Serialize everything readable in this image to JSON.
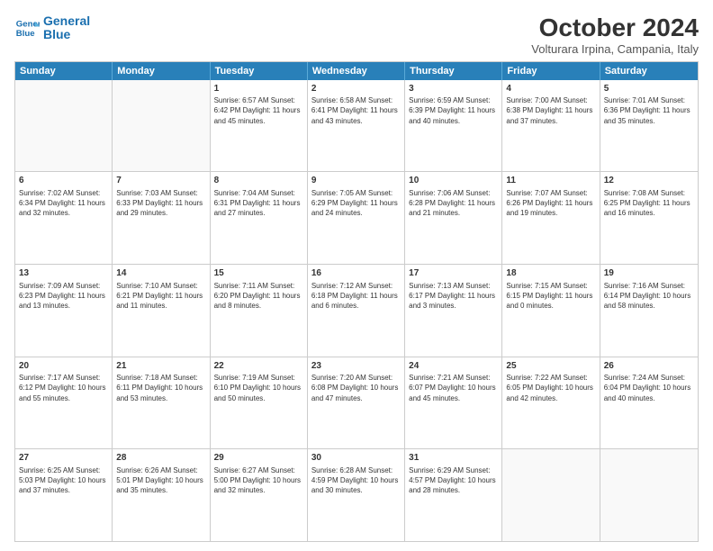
{
  "header": {
    "logo_line1": "General",
    "logo_line2": "Blue",
    "month_title": "October 2024",
    "location": "Volturara Irpina, Campania, Italy"
  },
  "weekdays": [
    "Sunday",
    "Monday",
    "Tuesday",
    "Wednesday",
    "Thursday",
    "Friday",
    "Saturday"
  ],
  "rows": [
    [
      {
        "day": "",
        "info": ""
      },
      {
        "day": "",
        "info": ""
      },
      {
        "day": "1",
        "info": "Sunrise: 6:57 AM\nSunset: 6:42 PM\nDaylight: 11 hours and 45 minutes."
      },
      {
        "day": "2",
        "info": "Sunrise: 6:58 AM\nSunset: 6:41 PM\nDaylight: 11 hours and 43 minutes."
      },
      {
        "day": "3",
        "info": "Sunrise: 6:59 AM\nSunset: 6:39 PM\nDaylight: 11 hours and 40 minutes."
      },
      {
        "day": "4",
        "info": "Sunrise: 7:00 AM\nSunset: 6:38 PM\nDaylight: 11 hours and 37 minutes."
      },
      {
        "day": "5",
        "info": "Sunrise: 7:01 AM\nSunset: 6:36 PM\nDaylight: 11 hours and 35 minutes."
      }
    ],
    [
      {
        "day": "6",
        "info": "Sunrise: 7:02 AM\nSunset: 6:34 PM\nDaylight: 11 hours and 32 minutes."
      },
      {
        "day": "7",
        "info": "Sunrise: 7:03 AM\nSunset: 6:33 PM\nDaylight: 11 hours and 29 minutes."
      },
      {
        "day": "8",
        "info": "Sunrise: 7:04 AM\nSunset: 6:31 PM\nDaylight: 11 hours and 27 minutes."
      },
      {
        "day": "9",
        "info": "Sunrise: 7:05 AM\nSunset: 6:29 PM\nDaylight: 11 hours and 24 minutes."
      },
      {
        "day": "10",
        "info": "Sunrise: 7:06 AM\nSunset: 6:28 PM\nDaylight: 11 hours and 21 minutes."
      },
      {
        "day": "11",
        "info": "Sunrise: 7:07 AM\nSunset: 6:26 PM\nDaylight: 11 hours and 19 minutes."
      },
      {
        "day": "12",
        "info": "Sunrise: 7:08 AM\nSunset: 6:25 PM\nDaylight: 11 hours and 16 minutes."
      }
    ],
    [
      {
        "day": "13",
        "info": "Sunrise: 7:09 AM\nSunset: 6:23 PM\nDaylight: 11 hours and 13 minutes."
      },
      {
        "day": "14",
        "info": "Sunrise: 7:10 AM\nSunset: 6:21 PM\nDaylight: 11 hours and 11 minutes."
      },
      {
        "day": "15",
        "info": "Sunrise: 7:11 AM\nSunset: 6:20 PM\nDaylight: 11 hours and 8 minutes."
      },
      {
        "day": "16",
        "info": "Sunrise: 7:12 AM\nSunset: 6:18 PM\nDaylight: 11 hours and 6 minutes."
      },
      {
        "day": "17",
        "info": "Sunrise: 7:13 AM\nSunset: 6:17 PM\nDaylight: 11 hours and 3 minutes."
      },
      {
        "day": "18",
        "info": "Sunrise: 7:15 AM\nSunset: 6:15 PM\nDaylight: 11 hours and 0 minutes."
      },
      {
        "day": "19",
        "info": "Sunrise: 7:16 AM\nSunset: 6:14 PM\nDaylight: 10 hours and 58 minutes."
      }
    ],
    [
      {
        "day": "20",
        "info": "Sunrise: 7:17 AM\nSunset: 6:12 PM\nDaylight: 10 hours and 55 minutes."
      },
      {
        "day": "21",
        "info": "Sunrise: 7:18 AM\nSunset: 6:11 PM\nDaylight: 10 hours and 53 minutes."
      },
      {
        "day": "22",
        "info": "Sunrise: 7:19 AM\nSunset: 6:10 PM\nDaylight: 10 hours and 50 minutes."
      },
      {
        "day": "23",
        "info": "Sunrise: 7:20 AM\nSunset: 6:08 PM\nDaylight: 10 hours and 47 minutes."
      },
      {
        "day": "24",
        "info": "Sunrise: 7:21 AM\nSunset: 6:07 PM\nDaylight: 10 hours and 45 minutes."
      },
      {
        "day": "25",
        "info": "Sunrise: 7:22 AM\nSunset: 6:05 PM\nDaylight: 10 hours and 42 minutes."
      },
      {
        "day": "26",
        "info": "Sunrise: 7:24 AM\nSunset: 6:04 PM\nDaylight: 10 hours and 40 minutes."
      }
    ],
    [
      {
        "day": "27",
        "info": "Sunrise: 6:25 AM\nSunset: 5:03 PM\nDaylight: 10 hours and 37 minutes."
      },
      {
        "day": "28",
        "info": "Sunrise: 6:26 AM\nSunset: 5:01 PM\nDaylight: 10 hours and 35 minutes."
      },
      {
        "day": "29",
        "info": "Sunrise: 6:27 AM\nSunset: 5:00 PM\nDaylight: 10 hours and 32 minutes."
      },
      {
        "day": "30",
        "info": "Sunrise: 6:28 AM\nSunset: 4:59 PM\nDaylight: 10 hours and 30 minutes."
      },
      {
        "day": "31",
        "info": "Sunrise: 6:29 AM\nSunset: 4:57 PM\nDaylight: 10 hours and 28 minutes."
      },
      {
        "day": "",
        "info": ""
      },
      {
        "day": "",
        "info": ""
      }
    ]
  ]
}
